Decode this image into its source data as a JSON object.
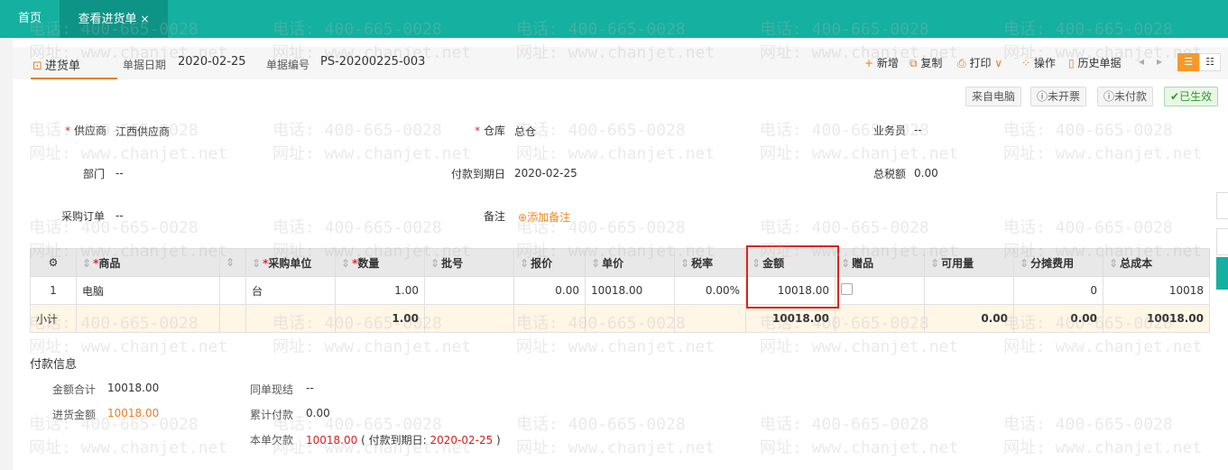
{
  "tabs": {
    "home": "首页",
    "active": "查看进货单",
    "close": "×"
  },
  "doc": {
    "name": "进货单",
    "date_label": "单据日期",
    "date": "2020-02-25",
    "no_label": "单据编号",
    "no": "PS-20200225-003"
  },
  "toolbar": {
    "add": "新增",
    "copy": "复制",
    "print": "打印",
    "ops": "操作",
    "history": "历史单据"
  },
  "statuses": {
    "from": "来自电脑",
    "invoice": "未开票",
    "payment": "未付款",
    "effective": "已生效"
  },
  "form": {
    "supplier_label": "供应商",
    "supplier": "江西供应商",
    "warehouse_label": "仓库",
    "warehouse": "总仓",
    "salesman_label": "业务员",
    "salesman": "--",
    "dept_label": "部门",
    "dept": "--",
    "due_label": "付款到期日",
    "due": "2020-02-25",
    "tax_label": "总税额",
    "tax": "0.00",
    "po_label": "采购订单",
    "po": "--",
    "note_label": "备注",
    "note_action": "添加备注"
  },
  "grid": {
    "headers": [
      "商品",
      "采购单位",
      "数量",
      "批号",
      "报价",
      "单价",
      "税率",
      "金额",
      "赠品",
      "可用量",
      "分摊费用",
      "总成本"
    ],
    "row": {
      "no": "1",
      "product": "电脑",
      "unit": "台",
      "qty": "1.00",
      "batch": "",
      "quote": "0.00",
      "price": "10018.00",
      "tax": "0.00%",
      "amount": "10018.00",
      "gift": "",
      "avail": "",
      "alloc": "0",
      "cost": "10018"
    },
    "subtotal": {
      "label": "小计",
      "qty": "1.00",
      "amount": "10018.00",
      "avail": "0.00",
      "alloc": "0.00",
      "cost": "10018.00"
    }
  },
  "payment": {
    "title": "付款信息",
    "total_label": "金额合计",
    "total": "10018.00",
    "purchase_label": "进货金额",
    "purchase": "10018.00",
    "cash_label": "同单现结",
    "cash": "--",
    "paid_label": "累计付款",
    "paid": "0.00",
    "owed_label": "本单欠款",
    "owed": "10018.00",
    "owed_note_prefix": "( 付款到期日:",
    "owed_note_date": "2020-02-25",
    "owed_note_suffix": ")"
  },
  "watermark": {
    "phone": "电话: 400-665-0028",
    "site": "网址: www.chanjet.net"
  },
  "colors": {
    "topbar": "#14b0a0",
    "accent": "#e67e22",
    "highlight": "#d9261c"
  }
}
